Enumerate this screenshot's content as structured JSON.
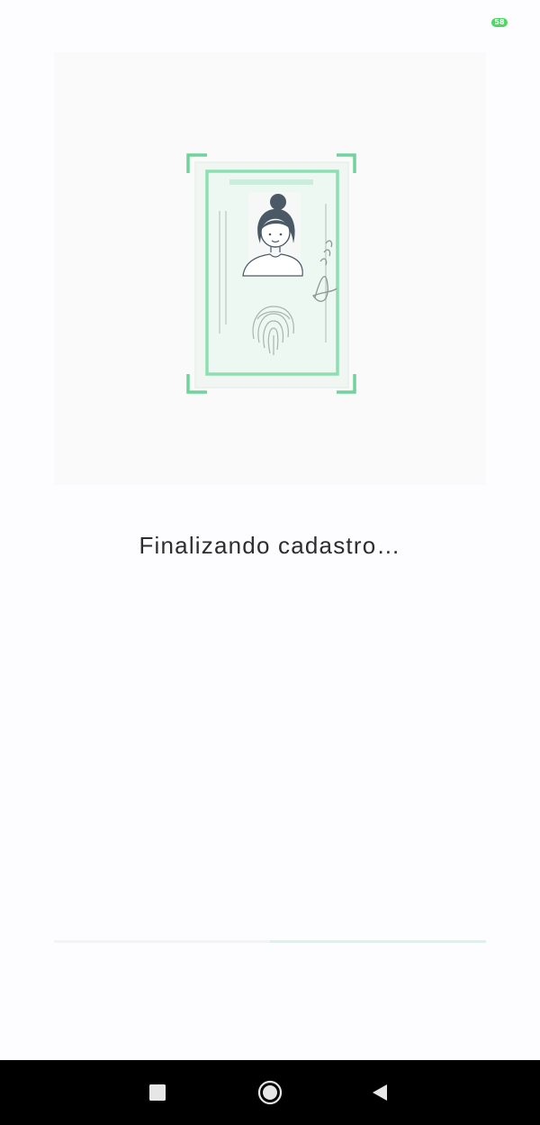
{
  "status_bar": {
    "battery_level": "58",
    "battery_color": "#4cd964"
  },
  "illustration": {
    "icons": [
      "id-document-icon",
      "scan-frame-icon",
      "portrait-icon",
      "fingerprint-icon",
      "signature-icon"
    ],
    "accent_color": "#6fd39b"
  },
  "main": {
    "status_message": "Finalizando cadastro…"
  },
  "progress": {
    "percent": 50,
    "fill_color": "#d9f3e4"
  },
  "nav_bar": {
    "buttons": [
      "recents-icon",
      "home-icon",
      "back-icon"
    ]
  }
}
